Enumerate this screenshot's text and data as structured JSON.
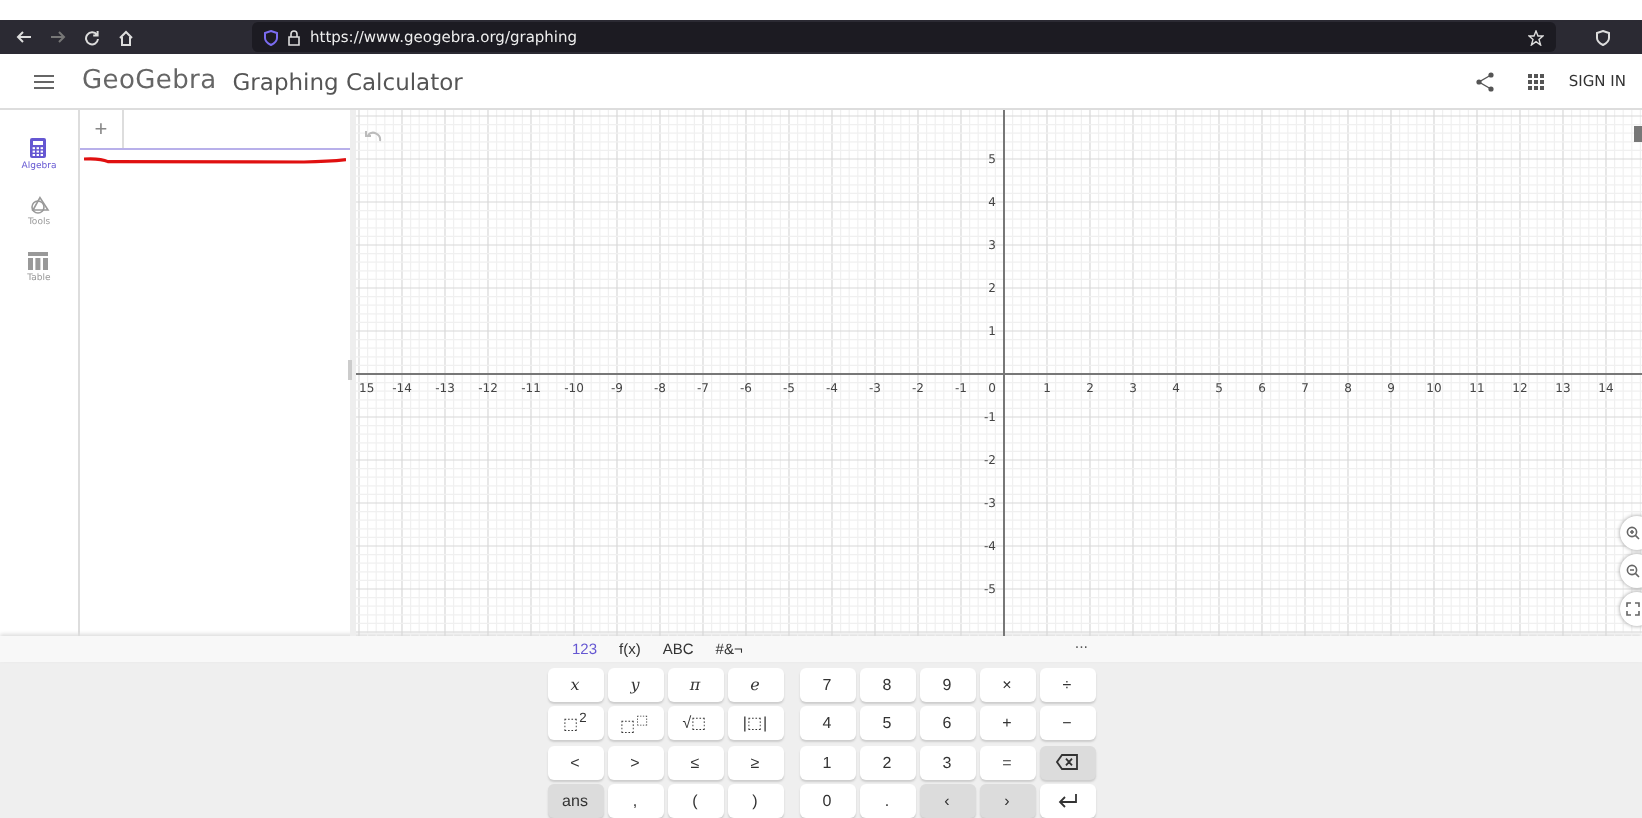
{
  "browser": {
    "url": "https://www.geogebra.org/graphing"
  },
  "header": {
    "logo": "GeoGebra",
    "title": "Graphing Calculator",
    "sign_in": "SIGN IN"
  },
  "sidebar": {
    "items": [
      {
        "label": "Algebra",
        "kind": "calculator",
        "selected": true
      },
      {
        "label": "Tools",
        "kind": "tools",
        "selected": false
      },
      {
        "label": "Table",
        "kind": "table",
        "selected": false
      }
    ]
  },
  "algebra": {
    "add": "+"
  },
  "graph": {
    "x_ticks": [
      "15",
      "-14",
      "-13",
      "-12",
      "-11",
      "-10",
      "-9",
      "-8",
      "-7",
      "-6",
      "-5",
      "-4",
      "-3",
      "-2",
      "-1",
      "0",
      "1",
      "2",
      "3",
      "4",
      "5",
      "6",
      "7",
      "8",
      "9",
      "10",
      "11",
      "12",
      "13",
      "14"
    ],
    "y_ticks": [
      "5",
      "4",
      "3",
      "2",
      "1",
      "-1",
      "-2",
      "-3",
      "-4",
      "-5"
    ]
  },
  "keyboard": {
    "tabs": [
      {
        "label": "123",
        "selected": true
      },
      {
        "label": "f(x)",
        "selected": false
      },
      {
        "label": "ABC",
        "selected": false
      },
      {
        "label": "#&¬",
        "selected": false
      }
    ],
    "more": "···",
    "left_keys": [
      {
        "label": "x",
        "kind": "var"
      },
      {
        "label": "y",
        "kind": "var"
      },
      {
        "label": "π",
        "kind": "var"
      },
      {
        "label": "e",
        "kind": "var"
      },
      {
        "label": "⬚$^{2}$",
        "kind": "text"
      },
      {
        "label": "⬚$^{⬚}$",
        "kind": "text"
      },
      {
        "label": "√⬚",
        "kind": "text"
      },
      {
        "label": "|⬚|",
        "kind": "text"
      },
      {
        "label": "<",
        "kind": "text"
      },
      {
        "label": ">",
        "kind": "text"
      },
      {
        "label": "≤",
        "kind": "text"
      },
      {
        "label": "≥",
        "kind": "text"
      },
      {
        "label": "ans",
        "kind": "action"
      },
      {
        "label": ",",
        "kind": "text"
      },
      {
        "label": "(",
        "kind": "text"
      },
      {
        "label": ")",
        "kind": "text"
      }
    ],
    "right_keys": [
      {
        "label": "7",
        "kind": "text"
      },
      {
        "label": "8",
        "kind": "text"
      },
      {
        "label": "9",
        "kind": "text"
      },
      {
        "label": "×",
        "kind": "text"
      },
      {
        "label": "÷",
        "kind": "text"
      },
      {
        "label": "4",
        "kind": "text"
      },
      {
        "label": "5",
        "kind": "text"
      },
      {
        "label": "6",
        "kind": "text"
      },
      {
        "label": "+",
        "kind": "text"
      },
      {
        "label": "−",
        "kind": "text"
      },
      {
        "label": "1",
        "kind": "text"
      },
      {
        "label": "2",
        "kind": "text"
      },
      {
        "label": "3",
        "kind": "text"
      },
      {
        "label": "=",
        "kind": "text"
      },
      {
        "kind": "backspace"
      },
      {
        "label": "0",
        "kind": "text"
      },
      {
        "label": ".",
        "kind": "text"
      },
      {
        "label": "‹",
        "kind": "action"
      },
      {
        "label": "›",
        "kind": "action"
      },
      {
        "kind": "enter"
      }
    ]
  }
}
